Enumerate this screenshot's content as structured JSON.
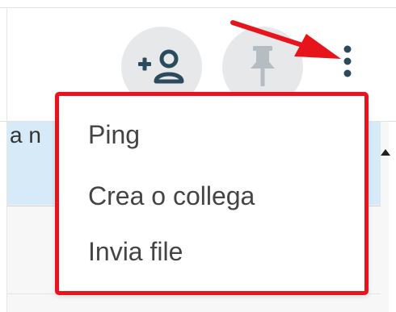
{
  "header": {
    "actions": [
      {
        "id": "add-user",
        "icon": "add-user-icon"
      },
      {
        "id": "pin",
        "icon": "pin-icon"
      },
      {
        "id": "more",
        "icon": "more-vertical-icon"
      }
    ]
  },
  "background": {
    "peek_text": "a n"
  },
  "menu": {
    "items": [
      {
        "label": "Ping"
      },
      {
        "label": "Crea o collega"
      },
      {
        "label": "Invia file"
      }
    ]
  },
  "colors": {
    "annotation_red": "#e8141b",
    "icon_dark": "#2b4a5c",
    "pin_gray": "#b5bcc2",
    "button_bg": "#e6e8ea",
    "selected_row": "#d6ebf7"
  }
}
